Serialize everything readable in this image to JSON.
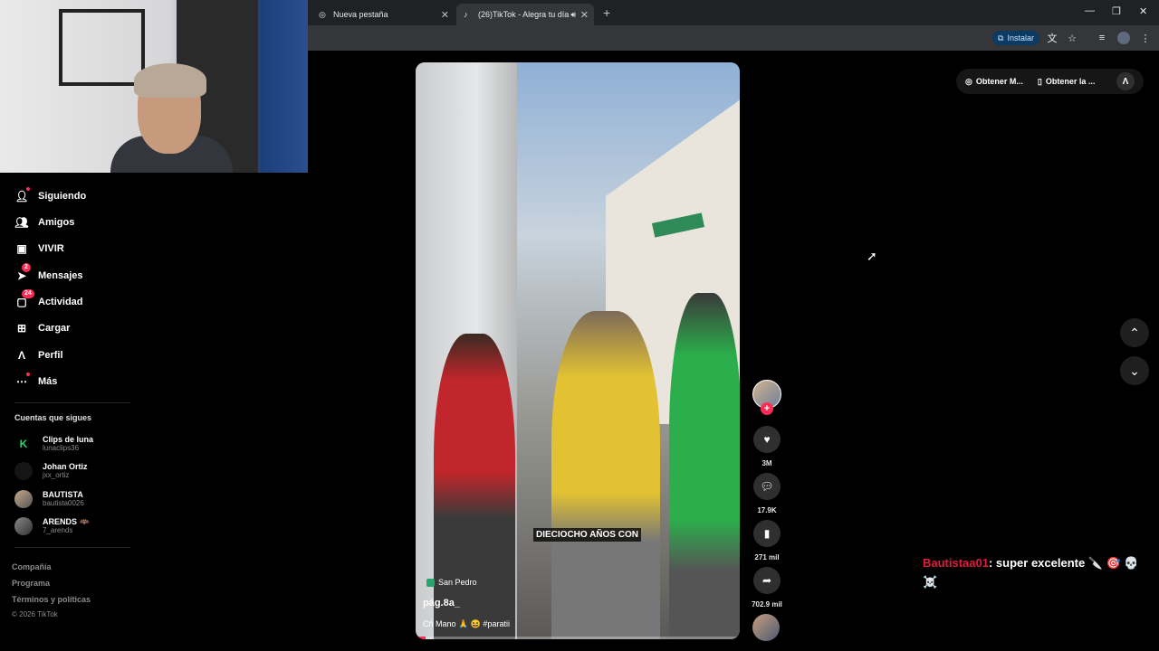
{
  "browser": {
    "tabs": [
      {
        "title": "Nueva pestaña"
      },
      {
        "title": "(26)TikTok - Alegra tu día"
      }
    ],
    "install_label": "Instalar"
  },
  "sidebar": {
    "items": [
      {
        "label": "Siguiendo",
        "icon": "following-icon",
        "dot": true
      },
      {
        "label": "Amigos",
        "icon": "friends-icon"
      },
      {
        "label": "VIVIR",
        "icon": "live-icon"
      },
      {
        "label": "Mensajes",
        "icon": "messages-icon",
        "badge": "2"
      },
      {
        "label": "Actividad",
        "icon": "activity-icon",
        "badge": "24"
      },
      {
        "label": "Cargar",
        "icon": "upload-icon"
      },
      {
        "label": "Perfil",
        "icon": "profile-icon"
      },
      {
        "label": "Más",
        "icon": "more-icon",
        "dot": true
      }
    ],
    "following_title": "Cuentas que sigues",
    "following": [
      {
        "name": "Clips de luna",
        "handle": "lunaclips36"
      },
      {
        "name": "Johan Ortiz",
        "handle": "jxx_ortiz"
      },
      {
        "name": "BAUTISTA",
        "handle": "bautista0026"
      },
      {
        "name": "ARENDS 🦇",
        "handle": "7_arends"
      }
    ],
    "footer": [
      "Compañía",
      "Programa",
      "Términos y políticas",
      "© 2026 TikTok"
    ]
  },
  "video": {
    "overlay_text": "DIECIOCHO AÑOS CON",
    "location": "San Pedro",
    "author": "pág.8a_",
    "caption": "Cñ Mano 🙏 😆 #paratii",
    "progress": 0.03
  },
  "actions": {
    "likes": "3M",
    "comments": "17.9K",
    "saves": "271 mil",
    "shares": "702.9 mil"
  },
  "top_bar": {
    "get_mobile": "Obtener M...",
    "get_app": "Obtener la ..."
  },
  "chat": {
    "user": "Bautistaa01",
    "message": ": super excelente 🔪 🎯 💀 ☠️"
  },
  "colors": {
    "accent": "#fe2c55",
    "chat_user": "#e31b3b"
  }
}
